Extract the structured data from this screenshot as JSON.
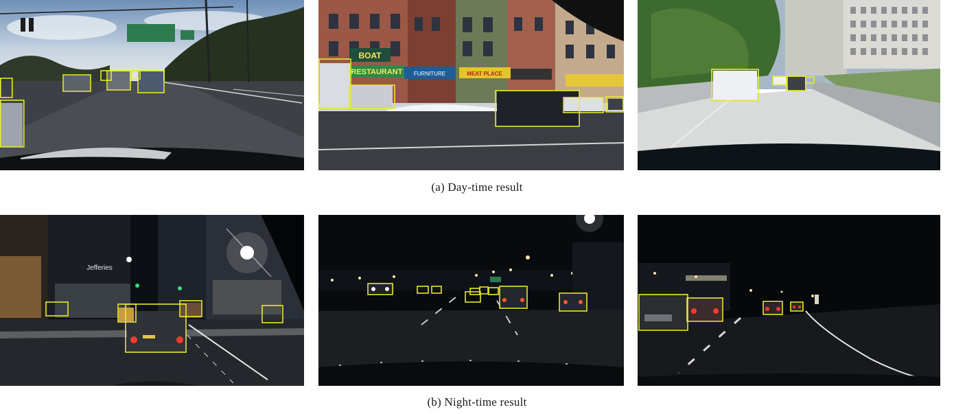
{
  "captions": {
    "day": "(a) Day-time result",
    "night": "(b) Night-time result"
  },
  "signs": {
    "day2_sign_text": "BOAT",
    "day2_store_text": "RESTAURANT",
    "day2_furniture": "FURNITURE",
    "day2_store2": "MEAT PLACE",
    "night1_sign": "Jefferies"
  },
  "colors": {
    "bbox": "#e6ea2e",
    "caption": "#1a1a1a"
  }
}
